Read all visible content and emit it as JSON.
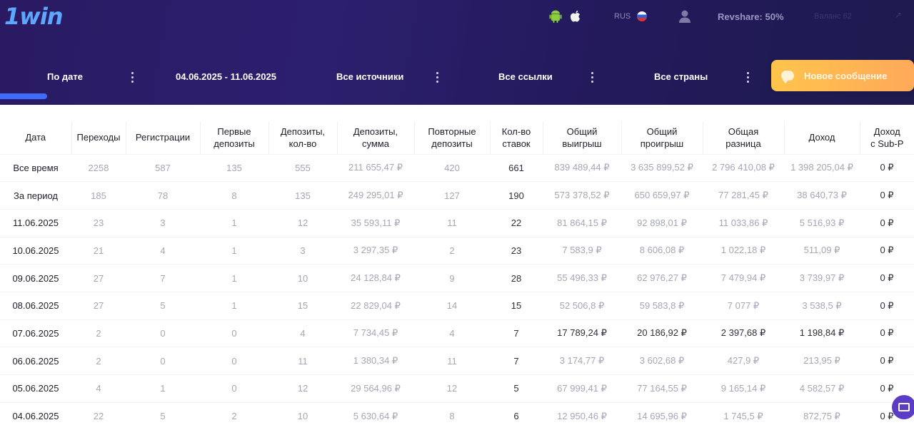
{
  "header": {
    "logo": "1win",
    "lang": "RUS",
    "revshare": "Revshare: 50%",
    "faded_text": "Baланс 62",
    "new_message_label": "Новое сообщение"
  },
  "filters": {
    "by_date": "По дате",
    "date_range": "04.06.2025 - 11.06.2025",
    "sources": "Все источники",
    "links": "Все ссылки",
    "countries": "Все страны"
  },
  "table": {
    "columns": [
      [
        "Дата"
      ],
      [
        "Переходы"
      ],
      [
        "Регистрации"
      ],
      [
        "Первые",
        "депозиты"
      ],
      [
        "Депозиты,",
        "кол-во"
      ],
      [
        "Депозиты,",
        "сумма"
      ],
      [
        "Повторные",
        "депозиты"
      ],
      [
        "Кол-во",
        "ставок"
      ],
      [
        "Общий",
        "выигрыш"
      ],
      [
        "Общий",
        "проигрыш"
      ],
      [
        "Общая",
        "разница"
      ],
      [
        "Доход"
      ],
      [
        "Доход",
        "с Sub-P"
      ]
    ],
    "rows": [
      [
        "Все время",
        "2258",
        "587",
        "135",
        "555",
        "211 655,47 ₽",
        "420",
        "661",
        "839 489,44 ₽",
        "3 635 899,52 ₽",
        "2 796 410,08 ₽",
        "1 398 205,04 ₽",
        "0 ₽"
      ],
      [
        "За период",
        "185",
        "78",
        "8",
        "135",
        "249 295,01 ₽",
        "127",
        "190",
        "573 378,52 ₽",
        "650 659,97 ₽",
        "77 281,45 ₽",
        "38 640,73 ₽",
        "0 ₽"
      ],
      [
        "11.06.2025",
        "23",
        "3",
        "1",
        "12",
        "35 593,11 ₽",
        "11",
        "22",
        "81 864,15 ₽",
        "92 898,01 ₽",
        "11 033,86 ₽",
        "5 516,93 ₽",
        "0 ₽"
      ],
      [
        "10.06.2025",
        "21",
        "4",
        "1",
        "3",
        "3 297,35 ₽",
        "2",
        "23",
        "7 583,9 ₽",
        "8 606,08 ₽",
        "1 022,18 ₽",
        "511,09 ₽",
        "0 ₽"
      ],
      [
        "09.06.2025",
        "27",
        "7",
        "1",
        "10",
        "24 128,84 ₽",
        "9",
        "28",
        "55 496,33 ₽",
        "62 976,27 ₽",
        "7 479,94 ₽",
        "3 739,97 ₽",
        "0 ₽"
      ],
      [
        "08.06.2025",
        "27",
        "5",
        "1",
        "15",
        "22 829,04 ₽",
        "14",
        "15",
        "52 506,8 ₽",
        "59 583,8 ₽",
        "7 077 ₽",
        "3 538,5 ₽",
        "0 ₽"
      ],
      [
        "07.06.2025",
        "2",
        "0",
        "0",
        "4",
        "7 734,45 ₽",
        "4",
        "7",
        "17 789,24 ₽",
        "20 186,92 ₽",
        "2 397,68 ₽",
        "1 198,84 ₽",
        "0 ₽"
      ],
      [
        "06.06.2025",
        "2",
        "0",
        "0",
        "11",
        "1 380,34 ₽",
        "11",
        "7",
        "3 174,77 ₽",
        "3 602,68 ₽",
        "427,9 ₽",
        "213,95 ₽",
        "0 ₽"
      ],
      [
        "05.06.2025",
        "4",
        "1",
        "0",
        "12",
        "29 564,96 ₽",
        "12",
        "5",
        "67 999,41 ₽",
        "77 164,55 ₽",
        "9 165,14 ₽",
        "4 582,57 ₽",
        "0 ₽"
      ],
      [
        "04.06.2025",
        "22",
        "5",
        "2",
        "10",
        "5 630,64 ₽",
        "8",
        "6",
        "12 950,46 ₽",
        "14 695,96 ₽",
        "1 745,5 ₽",
        "872,75 ₽",
        "0 ₽"
      ]
    ]
  }
}
